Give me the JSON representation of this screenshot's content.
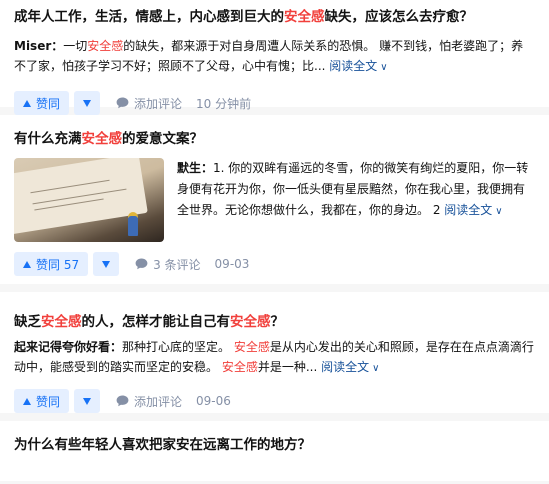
{
  "answers": [
    {
      "title": {
        "pre": "成年人工作，生活，情感上，内心感到巨大的",
        "hl": "安全感",
        "post": "缺失，应该怎么去疗愈？"
      },
      "excerpt": {
        "author": "Miser：",
        "parts": [
          "一切",
          "安全感",
          "的缺失，都来源于对自身周遭人际关系的恐惧。 赚不到钱，怕老婆跑了；养不了家，怕孩子学习不好；照顾不了父母，心中有愧；比..."
        ]
      },
      "read_all": "阅读全文",
      "vote_label": "赞同",
      "comment_label": "添加评论",
      "time": "10 分钟前"
    },
    {
      "title": {
        "pre": "有什么充满",
        "hl": "安全感",
        "post": "的爱意文案？"
      },
      "thumbnail_icon": "book-page-photo",
      "excerpt": {
        "author": "默生：",
        "text": "1. 你的双眸有遥远的冬雪，你的微笑有绚烂的夏阳，你一转身便有花开为你，你一低头便有星辰黯然，你在我心里，我便拥有全世界。无论你想做什么，我都在，你的身边。 2 "
      },
      "read_all": "阅读全文",
      "vote_label": "赞同 57",
      "comment_label": "3 条评论",
      "time": "09-03"
    },
    {
      "title": {
        "pre": "缺乏",
        "hl": "安全感",
        "mid": "的人，怎样才能让自己有",
        "hl2": "安全感",
        "post": "？"
      },
      "excerpt": {
        "author": "起来记得夸你好看：",
        "parts": [
          "那种打心底的坚定。 ",
          "安全感",
          "是从内心发出的关心和照顾，是存在在点点滴滴行动中，能感受到的踏实而坚定的安稳。 ",
          "安全感",
          "并是一种..."
        ]
      },
      "read_all": "阅读全文",
      "vote_label": "赞同",
      "comment_label": "添加评论",
      "time": "09-06"
    },
    {
      "title": {
        "pre": "为什么有些年轻人喜欢把家安在远离工作的地方？"
      }
    }
  ],
  "icons": {
    "vote_up": "triangle-up-icon",
    "vote_down": "triangle-down-icon",
    "comment": "comment-bubble-icon",
    "read_all": "chevron-down-icon"
  },
  "colors": {
    "highlight": "#f1403c",
    "link": "#175199",
    "vote": "#1772f6",
    "vote_bg": "#e5efff",
    "meta": "#8590a6"
  }
}
